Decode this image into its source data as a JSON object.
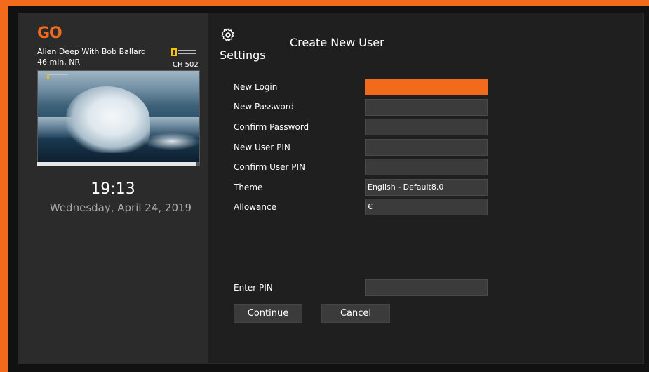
{
  "brand": {
    "logo_text": "GO",
    "accent_color": "#f26a1b"
  },
  "now_playing": {
    "title": "Alien Deep With Bob Ballard",
    "meta": "46 min, NR",
    "channel": "CH 502",
    "channel_logo": "national-geographic-logo",
    "progress": 0.98
  },
  "clock": {
    "time": "19:13",
    "date": "Wednesday, April 24, 2019"
  },
  "header": {
    "settings_icon": "gear-icon",
    "settings_label": "Settings",
    "page_title": "Create New User"
  },
  "form": {
    "new_login": {
      "label": "New Login",
      "value": ""
    },
    "new_password": {
      "label": "New Password",
      "value": ""
    },
    "confirm_password": {
      "label": "Confirm Password",
      "value": ""
    },
    "new_user_pin": {
      "label": "New User PIN",
      "value": ""
    },
    "confirm_user_pin": {
      "label": "Confirm User PIN",
      "value": ""
    },
    "theme": {
      "label": "Theme",
      "value": "English - Default8.0"
    },
    "allowance": {
      "label": "Allowance",
      "value": "€"
    },
    "enter_pin": {
      "label": "Enter PIN",
      "value": ""
    }
  },
  "actions": {
    "continue_label": "Continue",
    "cancel_label": "Cancel"
  }
}
